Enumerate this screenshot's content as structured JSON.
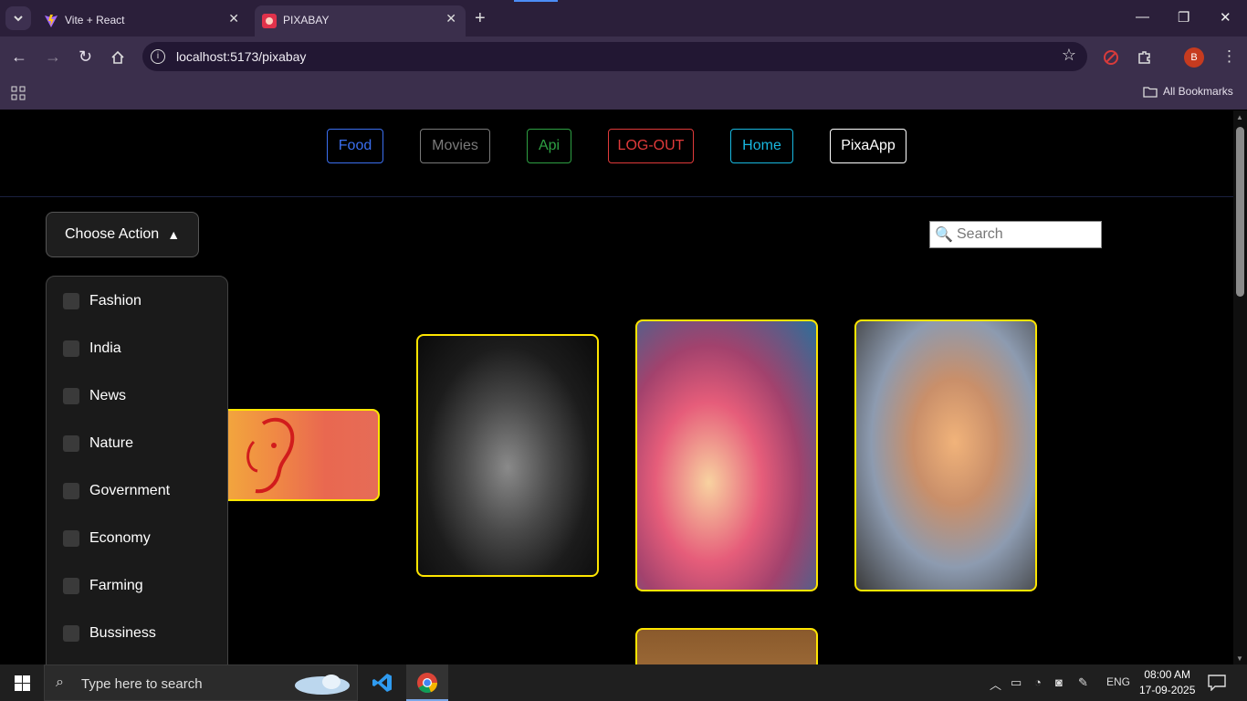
{
  "browser": {
    "tabs": [
      {
        "title": "Vite + React"
      },
      {
        "title": "PIXABAY"
      }
    ],
    "url": "localhost:5173/pixabay",
    "bookmarks_label": "All Bookmarks",
    "profile_initial": "B"
  },
  "page": {
    "nav_buttons": [
      {
        "label": "Food",
        "color": "#3b6ff0"
      },
      {
        "label": "Movies",
        "color": "#7a7a7a"
      },
      {
        "label": "Api",
        "color": "#2ea043"
      },
      {
        "label": "LOG-OUT",
        "color": "#e03a3a"
      },
      {
        "label": "Home",
        "color": "#18b8e0"
      },
      {
        "label": "PixaApp",
        "color": "#ffffff"
      }
    ],
    "choose_action": "Choose Action",
    "search_placeholder": "Search",
    "categories": [
      "Fashion",
      "India",
      "News",
      "Nature",
      "Government",
      "Economy",
      "Farming",
      "Bussiness"
    ],
    "card_border_color": "#ffe600"
  },
  "taskbar": {
    "search_placeholder": "Type here to search",
    "language": "ENG",
    "time": "08:00 AM",
    "date": "17-09-2025"
  }
}
